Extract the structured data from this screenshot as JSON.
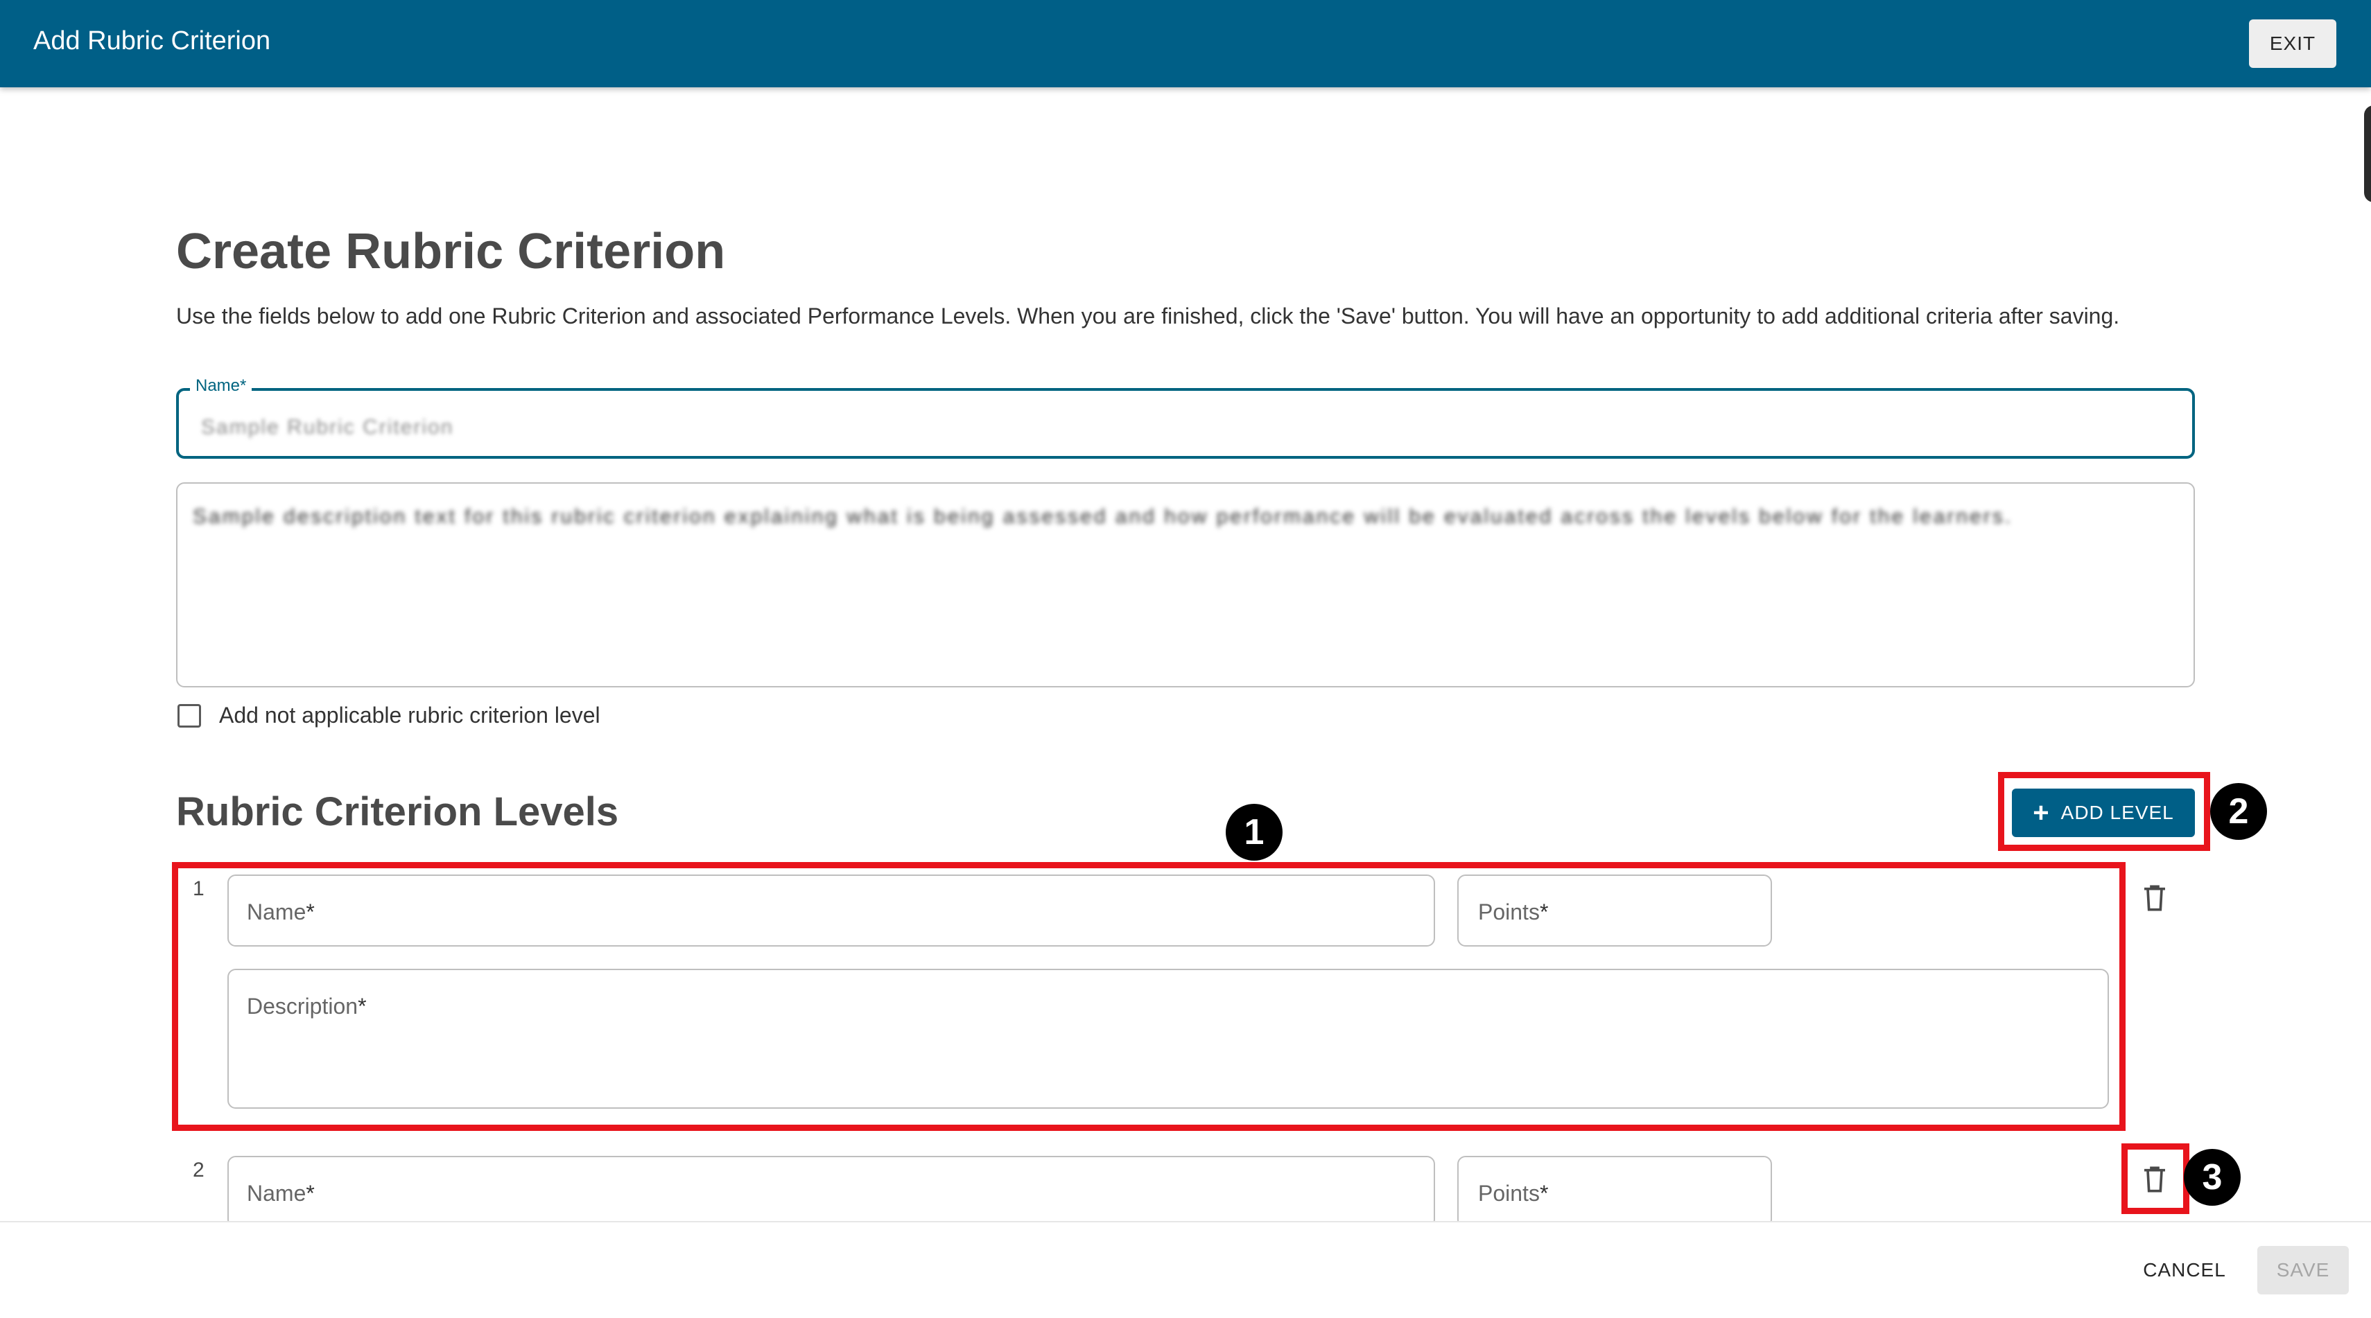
{
  "appbar": {
    "title": "Add Rubric Criterion",
    "exit_label": "EXIT"
  },
  "form": {
    "title": "Create Rubric Criterion",
    "intro": "Use the fields below to add one Rubric Criterion and associated Performance Levels. When you are finished, click the 'Save' button. You will have an opportunity to add additional criteria after saving.",
    "name_label": "Name",
    "required_mark": "*",
    "name_value": "Sample Rubric Criterion",
    "description_value": "Sample description text for this rubric criterion explaining what is being assessed and how performance will be evaluated across the levels below for the learners."
  },
  "not_applicable": {
    "label": "Add not applicable rubric criterion level",
    "checked": false
  },
  "levels": {
    "title": "Rubric Criterion Levels",
    "add_label": "ADD LEVEL",
    "items": [
      {
        "number": "1",
        "name_label": "Name",
        "points_label": "Points",
        "description_label": "Description"
      },
      {
        "number": "2",
        "name_label": "Name",
        "points_label": "Points"
      }
    ]
  },
  "annotations": [
    "1",
    "2",
    "3"
  ],
  "footer": {
    "cancel_label": "CANCEL",
    "save_label": "SAVE"
  },
  "colors": {
    "primary": "#005f87",
    "annotation_red": "#e8141c",
    "annotation_badge": "#000000"
  }
}
